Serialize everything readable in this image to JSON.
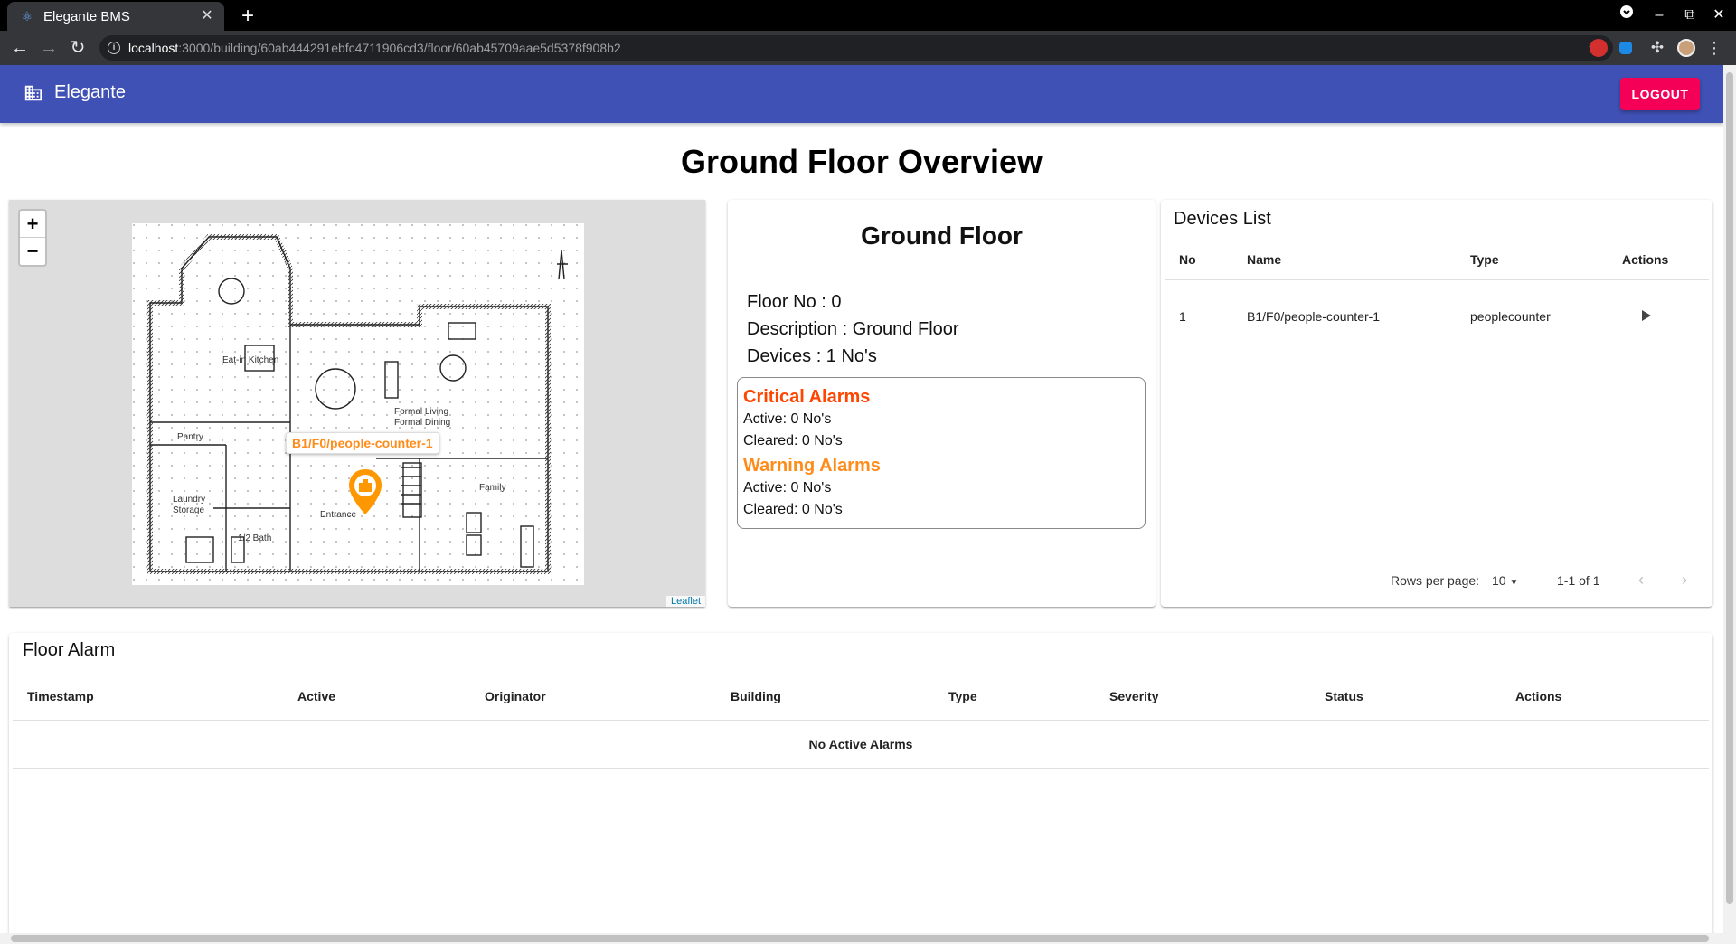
{
  "browser": {
    "tab_title": "Elegante BMS",
    "url_host": "localhost",
    "url_rest": ":3000/building/60ab444291ebfc4711906cd3/floor/60ab45709aae5d5378f908b2"
  },
  "appbar": {
    "brand": "Elegante",
    "logout_label": "LOGOUT",
    "color": "#3f51b5",
    "logout_color": "#f50057"
  },
  "page_title": "Ground Floor Overview",
  "map": {
    "zoom_in": "+",
    "zoom_out": "−",
    "attribution": "Leaflet",
    "marker_label": "B1/F0/people-counter-1",
    "marker_color": "#ff8c1a",
    "plan_labels": {
      "kitchen": "Eat-in Kitchen",
      "pantry": "Pantry",
      "living": "Formal Living",
      "dining": "Formal Dining",
      "laundry": "Laundry",
      "storage": "Storage",
      "bath": "1/2 Bath",
      "entrance": "Entrance",
      "family": "Family"
    }
  },
  "floor": {
    "title": "Ground Floor",
    "floor_no": "Floor No : 0",
    "description": "Description : Ground Floor",
    "devices": "Devices : 1 No's",
    "critical_title": "Critical Alarms",
    "critical_active": "Active: 0 No's",
    "critical_cleared": "Cleared: 0 No's",
    "warning_title": "Warning Alarms",
    "warning_active": "Active: 0 No's",
    "warning_cleared": "Cleared: 0 No's",
    "critical_color": "#ff4500",
    "warning_color": "#ff8c1a"
  },
  "devices": {
    "title": "Devices List",
    "columns": [
      "No",
      "Name",
      "Type",
      "Actions"
    ],
    "rows": [
      {
        "no": "1",
        "name": "B1/F0/people-counter-1",
        "type": "peoplecounter"
      }
    ],
    "rows_per_page_label": "Rows per page:",
    "rows_per_page": "10",
    "range": "1-1 of 1"
  },
  "floor_alarm": {
    "title": "Floor Alarm",
    "columns": [
      "Timestamp",
      "Active",
      "Originator",
      "Building",
      "Type",
      "Severity",
      "Status",
      "Actions"
    ],
    "empty": "No Active Alarms"
  }
}
